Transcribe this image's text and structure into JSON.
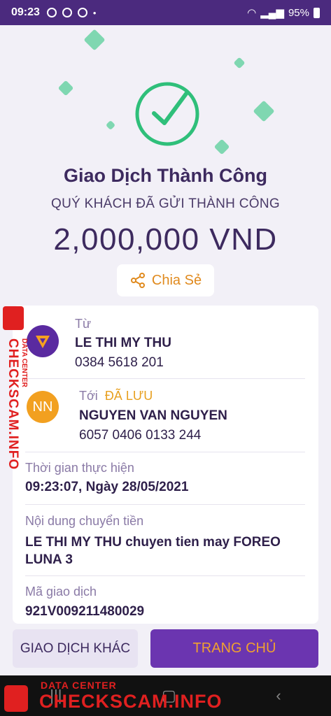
{
  "status_bar": {
    "time": "09:23",
    "battery": "95%"
  },
  "hero": {
    "title": "Giao Dịch Thành Công",
    "subtitle": "QUÝ KHÁCH ĐÃ GỬI THÀNH CÔNG",
    "amount": "2,000,000 VND",
    "share_label": "Chia Sẻ"
  },
  "from": {
    "label": "Từ",
    "name": "LE THI MY THU",
    "phone": "0384 5618 201"
  },
  "to": {
    "label": "Tới",
    "saved": "ĐÃ LƯU",
    "initials": "NN",
    "name": "NGUYEN VAN NGUYEN",
    "account": "6057 0406 0133 244"
  },
  "time": {
    "label": "Thời gian thực hiện",
    "value": "09:23:07, Ngày 28/05/2021"
  },
  "content": {
    "label": "Nội dung chuyển tiền",
    "value": "LE THI MY THU chuyen tien may FOREO LUNA 3"
  },
  "transaction": {
    "label": "Mã giao dịch",
    "value": "921V009211480029"
  },
  "buttons": {
    "other": "GIAO DỊCH KHÁC",
    "home": "TRANG CHỦ"
  },
  "watermark": {
    "brand": "CHECKSCAM.INFO",
    "sub": "DATA CENTER"
  },
  "colors": {
    "purple": "#4b2a7e",
    "accent": "#f0a030",
    "success": "#2fbf7a"
  }
}
